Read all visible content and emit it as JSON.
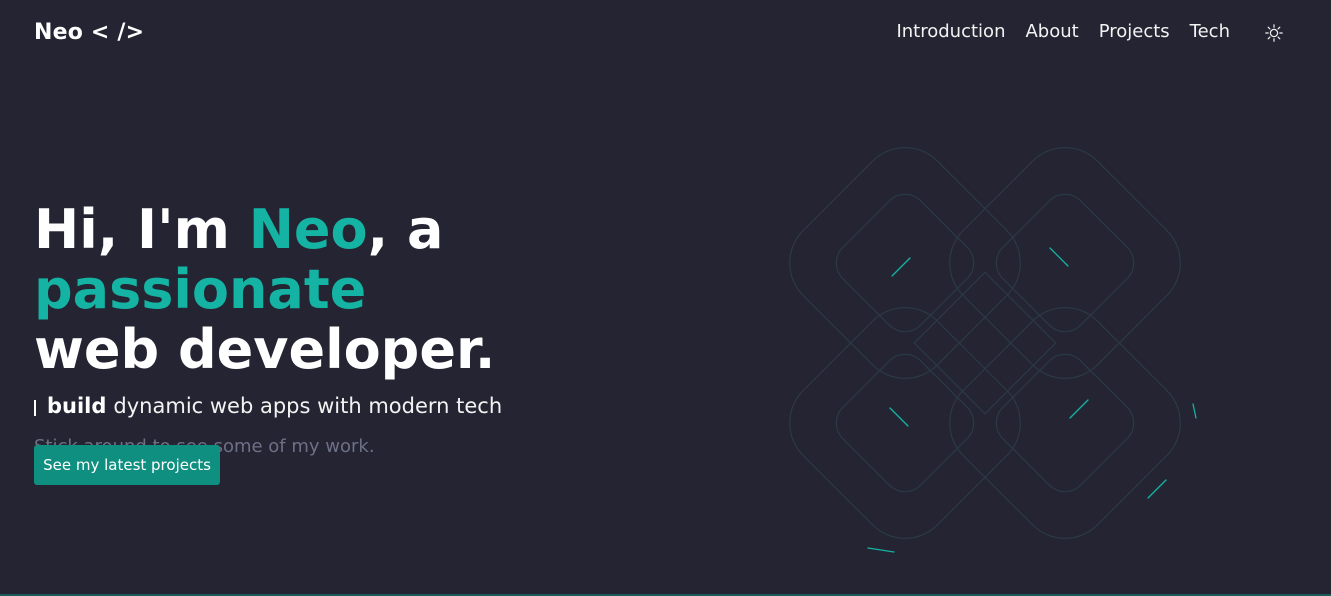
{
  "header": {
    "logo": "Neo < />",
    "nav": [
      "Introduction",
      "About",
      "Projects",
      "Tech"
    ],
    "theme_icon": "sun-icon"
  },
  "hero": {
    "headline_part1": "Hi, I'm ",
    "headline_name": "Neo",
    "headline_part2": ", a ",
    "headline_accent": "passionate",
    "headline_line2": "web developer.",
    "subline_bold": "build",
    "subline_rest": "dynamic web apps with modern tech",
    "tagline": "Stick around to see some of my work.",
    "cta_label": "See my latest projects"
  },
  "colors": {
    "background": "#242432",
    "accent": "#14b3a3",
    "button": "#0f8f80",
    "muted": "#6d7187"
  }
}
